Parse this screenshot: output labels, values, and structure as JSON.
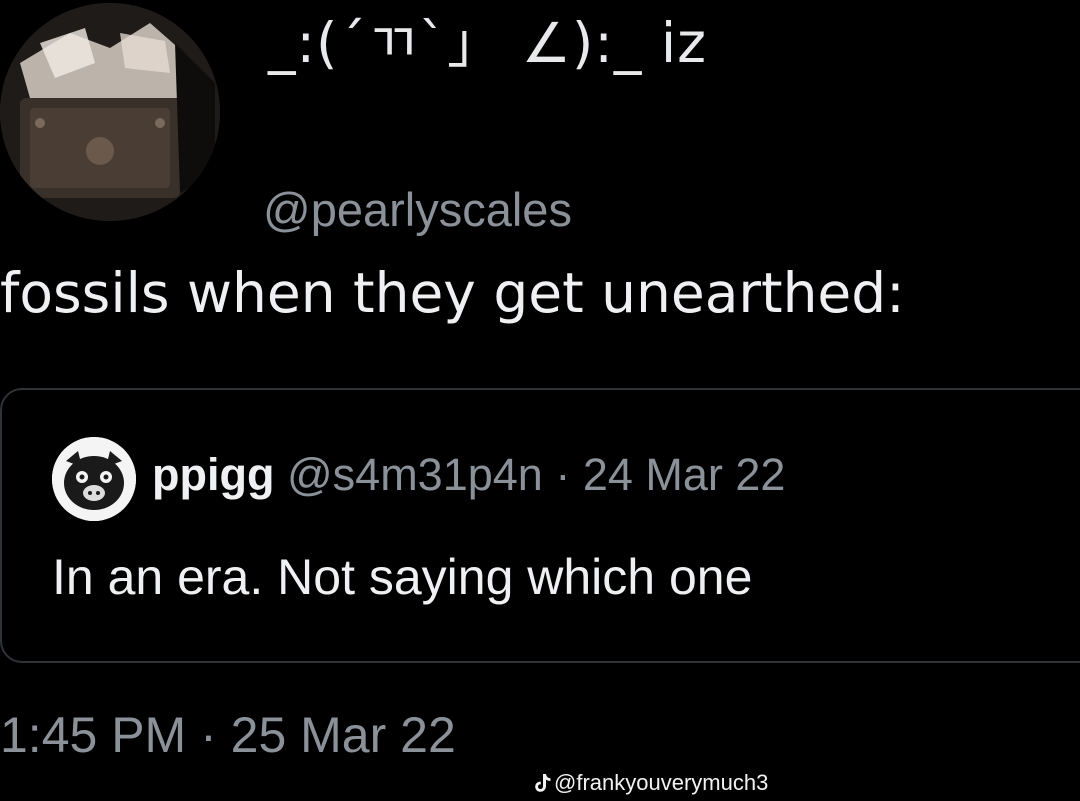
{
  "tweet": {
    "author": {
      "display_name": "_:(´ㄲ`」 ∠):_ iz",
      "handle": "@pearlyscales",
      "avatar_icon": "profile-photo"
    },
    "text": "fossils when they get unearthed:",
    "quoted_tweet": {
      "author_name": "ppigg",
      "author_handle": "@s4m31p4n",
      "separator": " · ",
      "date": "24 Mar 22",
      "text": "In an era. Not saying which one",
      "avatar_icon": "pig-avatar"
    },
    "timestamp": "1:45 PM · 25 Mar 22"
  },
  "watermark": {
    "icon": "tiktok-icon",
    "text": "@frankyouverymuch3"
  },
  "colors": {
    "background": "#000000",
    "primary_text": "#e7e9ea",
    "secondary_text": "#8b9198",
    "border": "#2f3336"
  }
}
